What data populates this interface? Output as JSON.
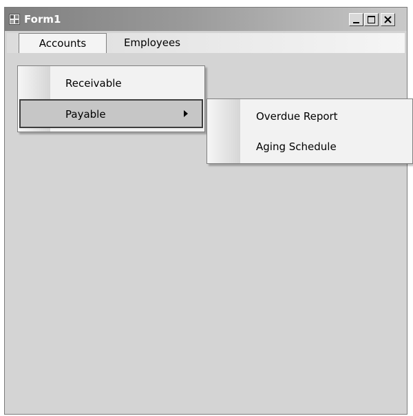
{
  "window": {
    "title": "Form1"
  },
  "menubar": {
    "items": [
      {
        "label": "Accounts"
      },
      {
        "label": "Employees"
      }
    ]
  },
  "accounts_menu": {
    "items": [
      {
        "label": "Receivable"
      },
      {
        "label": "Payable"
      }
    ]
  },
  "payable_submenu": {
    "items": [
      {
        "label": "Overdue Report"
      },
      {
        "label": "Aging Schedule"
      }
    ]
  },
  "icons": [
    "app-icon",
    "minimize-icon",
    "maximize-icon",
    "close-icon",
    "submenu-arrow-icon"
  ]
}
